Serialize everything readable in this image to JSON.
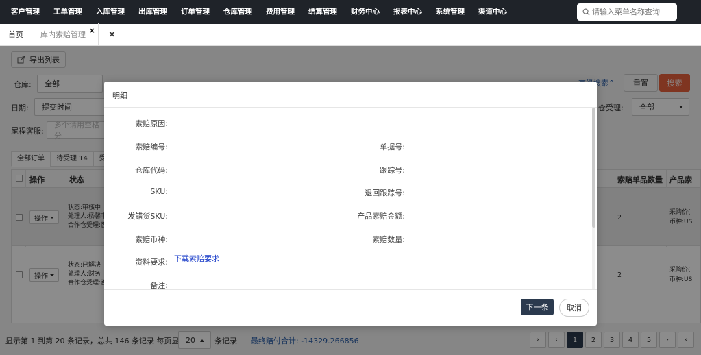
{
  "topnav": {
    "menu": [
      "客户管理",
      "工单管理",
      "入库管理",
      "出库管理",
      "订单管理",
      "仓库管理",
      "费用管理",
      "结算管理",
      "财务中心",
      "报表中心",
      "系统管理",
      "渠道中心"
    ],
    "search_placeholder": "请输入菜单名称查询"
  },
  "tabs": {
    "home": "首页",
    "active": "库内索赔管理",
    "close_mark": "×"
  },
  "toolbar": {
    "export_label": "导出列表"
  },
  "filters": {
    "warehouse_label": "仓库:",
    "warehouse_value": "全部",
    "date_label": "日期:",
    "date_value": "提交时间",
    "tail_label": "尾程客服:",
    "tail_placeholder": "多个请用空格分",
    "coop_label": "仓受理:",
    "coop_value": "全部",
    "advanced_link": "高级搜索^",
    "reset_label": "重置",
    "search_label": "搜索"
  },
  "status_tabs": [
    "全部订单",
    "待受理 14",
    "受理"
  ],
  "table": {
    "headers": {
      "op": "操作",
      "status": "状态",
      "qty": "索赔单品数量",
      "product": "产品索"
    },
    "rows": [
      {
        "op_label": "操作",
        "status": "状态:审核中",
        "handler": "处理人:杨馨丰",
        "coop": "合作仓受理:否",
        "qty": "2",
        "price": "采购价(",
        "currency": "币种:US"
      },
      {
        "op_label": "操作",
        "status": "状态:已解决",
        "handler": "处理人:财务",
        "coop": "合作仓受理:否",
        "qty": "2",
        "price": "采购价(",
        "currency": "币种:US"
      }
    ]
  },
  "footer": {
    "info": "显示第 1 到第 20 条记录，总共 146 条记录 每页显示",
    "page_size": "20",
    "tail": "条记录",
    "total": "最终赔付合计: -14329.266856",
    "pages": [
      "«",
      "‹",
      "1",
      "2",
      "3",
      "4",
      "5",
      "›",
      "»"
    ],
    "active_page": "1"
  },
  "modal": {
    "title": "明细",
    "fields": {
      "reason": "索赔原因:",
      "claim_no": "索赔编号:",
      "doc_no": "单据号:",
      "wh_code": "仓库代码:",
      "tracking": "跟踪号:",
      "sku": "SKU:",
      "return_tracking": "退回跟踪号:",
      "wrong_sku": "发错货SKU:",
      "product_amount": "产品索赔金额:",
      "currency": "索赔币种:",
      "claim_qty": "索赔数量:",
      "material": "资料要求:",
      "material_link": "下载索赔要求",
      "remark": "备注:"
    },
    "next_label": "下一条",
    "cancel_label": "取消"
  }
}
